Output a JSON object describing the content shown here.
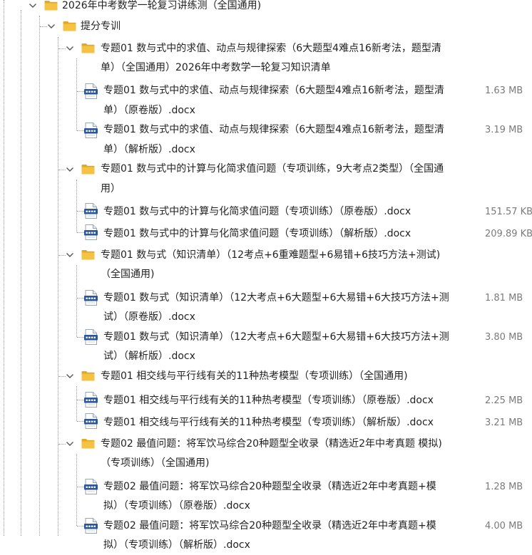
{
  "tree": {
    "root": {
      "label": "2026年中考数学一轮复习讲练测（全国通用)",
      "icon": "folder-icon"
    },
    "section": {
      "label": "提分专训",
      "icon": "folder-icon"
    },
    "folders": [
      {
        "line1": "专题01 数与式中的求值、动点与规律探索（6大题型4难点16新考法，题型清",
        "line2": "单）（全国通用）2026年中考数学一轮复习知识清单",
        "files": [
          {
            "line1": "专题01 数与式中的求值、动点与规律探索（6大题型4难点16新考法，题型清",
            "line2": "单）（原卷版）.docx",
            "size": "1.63 MB"
          },
          {
            "line1": "专题01 数与式中的求值、动点与规律探索（6大题型4难点16新考法，题型清",
            "line2": "单）（解析版）.docx",
            "size": "3.19 MB"
          }
        ]
      },
      {
        "line1": "专题01 数与式中的计算与化简求值问题（专项训练，9大考点2类型）（全国通",
        "line2": "用）",
        "files": [
          {
            "line1": "专题01 数与式中的计算与化简求值问题（专项训练）（原卷版）.docx",
            "size": "151.57 KB"
          },
          {
            "line1": "专题01 数与式中的计算与化简求值问题（专项训练）（解析版）.docx",
            "size": "209.89 KB"
          }
        ]
      },
      {
        "line1": "专题01 数与式（知识清单）（12考点+6重难题型+6易错+6技巧方法+测试)",
        "line2": "（全国通用)",
        "files": [
          {
            "line1": "专题01 数与式（知识清单）（12大考点+6大题型+6大易错+6大技巧方法+测",
            "line2": "试）（原卷版）.docx",
            "size": "1.81 MB"
          },
          {
            "line1": "专题01 数与式（知识清单）（12大考点+6大题型+6大易错+6大技巧方法+测",
            "line2": "试）（解析版）.docx",
            "size": "3.80 MB"
          }
        ]
      },
      {
        "line1": "专题01 相交线与平行线有关的11种热考模型（专项训练）（全国通用)",
        "files": [
          {
            "line1": "专题01 相交线与平行线有关的11种热考模型（专项训练）（原卷版）.docx",
            "size": "2.25 MB"
          },
          {
            "line1": "专题01 相交线与平行线有关的11种热考模型（专项训练）（解析版）.docx",
            "size": "3.21 MB"
          }
        ]
      },
      {
        "line1": "专题02 最值问题：将军饮马综合20种题型全收录（精选近2年中考真题 模拟)",
        "line2": "（专项训练）（全国通用)",
        "files": [
          {
            "line1": "专题02 最值问题：将军饮马综合20种题型全收录（精选近2年中考真题+模",
            "line2": "拟）（专项训练）（原卷版）.docx",
            "size": "1.28 MB"
          },
          {
            "line1": "专题02 最值问题：将军饮马综合20种题型全收录（精选近2年中考真题+模",
            "line2": "拟）（专项训练）（解析版）.docx",
            "size": "4.00 MB"
          }
        ]
      }
    ]
  },
  "colors": {
    "folder": "#f5c242",
    "folder_dark": "#e0a92a",
    "doc_blue": "#2b579a",
    "size_text": "#7a7a7a"
  }
}
